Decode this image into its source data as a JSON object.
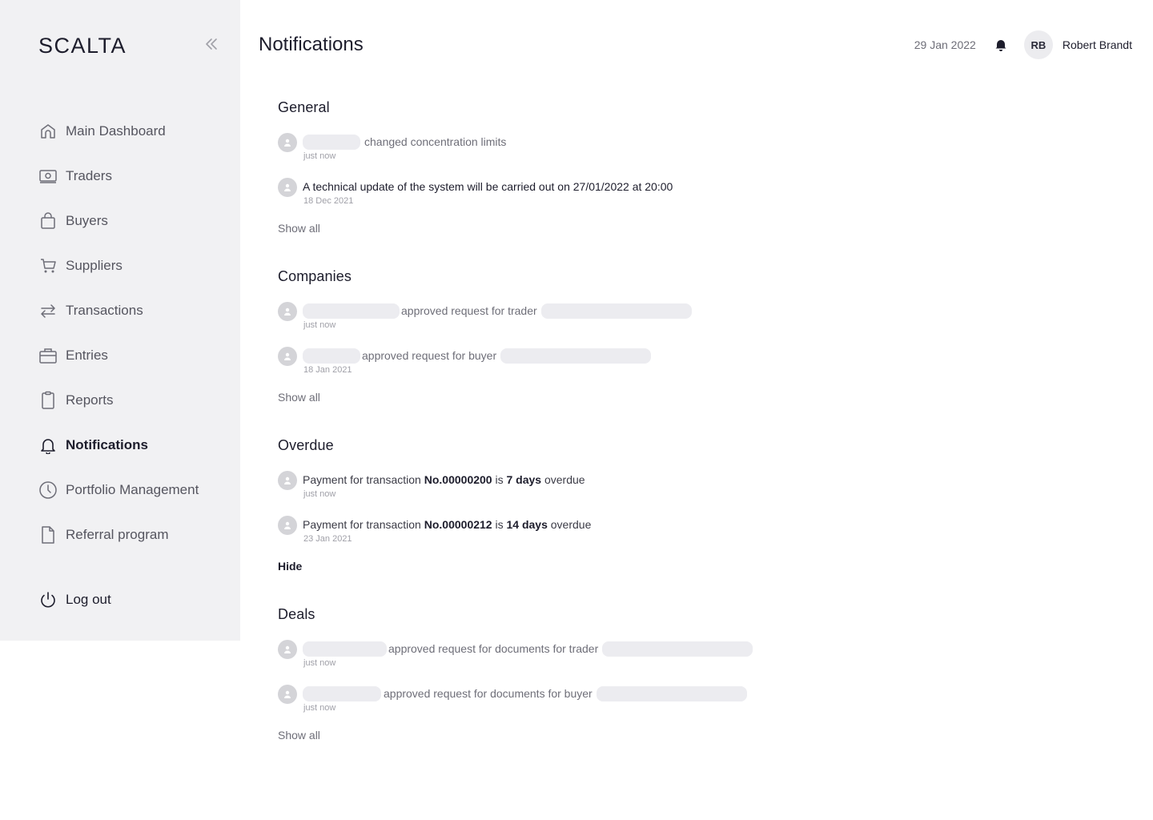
{
  "app": {
    "logo": "SCALTA"
  },
  "sidebar": {
    "items": [
      {
        "label": "Main Dashboard",
        "icon": "home-icon"
      },
      {
        "label": "Traders",
        "icon": "banknote-icon"
      },
      {
        "label": "Buyers",
        "icon": "shopping-bag-icon"
      },
      {
        "label": "Suppliers",
        "icon": "cart-icon"
      },
      {
        "label": "Transactions",
        "icon": "swap-arrows-icon"
      },
      {
        "label": "Entries",
        "icon": "briefcase-icon"
      },
      {
        "label": "Reports",
        "icon": "clipboard-icon"
      },
      {
        "label": "Notifications",
        "icon": "bell-icon",
        "active": true
      },
      {
        "label": "Portfolio Management",
        "icon": "clock-icon"
      },
      {
        "label": "Referral program",
        "icon": "document-icon"
      }
    ],
    "logout_label": "Log out"
  },
  "header": {
    "title": "Notifications",
    "date": "29 Jan 2022",
    "user_initials": "RB",
    "user_name": "Robert Brandt"
  },
  "sections": {
    "general": {
      "title": "General",
      "items": [
        {
          "text": "changed concentration limits",
          "time": "just now"
        },
        {
          "text": "A technical update of the system will be carried out on 27/01/2022 at 20:00",
          "time": "18 Dec 2021"
        }
      ],
      "link": "Show all"
    },
    "companies": {
      "title": "Companies",
      "items": [
        {
          "text": "approved request for trader",
          "time": "just now"
        },
        {
          "text": "approved request for buyer",
          "time": "18 Jan 2021"
        }
      ],
      "link": "Show all"
    },
    "overdue": {
      "title": "Overdue",
      "items": [
        {
          "prefix": "Payment for transaction",
          "number": "No.00000200",
          "is": "is",
          "days": "7 days",
          "suffix": "overdue",
          "time": "just now"
        },
        {
          "prefix": "Payment for transaction",
          "number": "No.00000212",
          "is": "is",
          "days": "14 days",
          "suffix": "overdue",
          "time": "23 Jan 2021"
        }
      ],
      "link": "Hide"
    },
    "deals": {
      "title": "Deals",
      "items": [
        {
          "text": "approved request for documents for trader",
          "time": "just now"
        },
        {
          "text": "approved request for documents for buyer",
          "time": "just now"
        }
      ],
      "link": "Show all"
    }
  },
  "colors": {
    "sidebar_bg": "#f1f1f3",
    "text_primary": "#1d1d2c",
    "text_muted": "#6e6e78",
    "placeholder_bg": "#ececf0",
    "avatar_bg": "#d4d4d8"
  }
}
